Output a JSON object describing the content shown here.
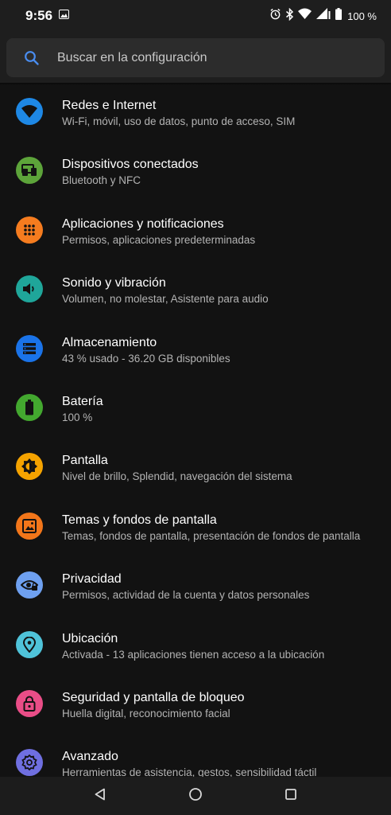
{
  "status_bar": {
    "time": "9:56",
    "battery_text": "100 %",
    "icons": [
      "image-icon",
      "alarm-icon",
      "bluetooth-icon",
      "wifi-icon",
      "signal-icon",
      "battery-icon"
    ]
  },
  "search": {
    "placeholder": "Buscar en la configuración"
  },
  "settings": [
    {
      "title": "Redes e Internet",
      "subtitle": "Wi-Fi, móvil, uso de datos, punto de acceso, SIM",
      "icon": "wifi-icon",
      "color": "#1e88e5"
    },
    {
      "title": "Dispositivos conectados",
      "subtitle": "Bluetooth y NFC",
      "icon": "devices-icon",
      "color": "#5da43a"
    },
    {
      "title": "Aplicaciones y notificaciones",
      "subtitle": "Permisos, aplicaciones predeterminadas",
      "icon": "apps-grid-icon",
      "color": "#f57c1f"
    },
    {
      "title": "Sonido y vibración",
      "subtitle": "Volumen, no molestar, Asistente para audio",
      "icon": "volume-icon",
      "color": "#1fa69a"
    },
    {
      "title": "Almacenamiento",
      "subtitle": "43 % usado - 36.20 GB disponibles",
      "icon": "storage-icon",
      "color": "#1a73e8"
    },
    {
      "title": "Batería",
      "subtitle": "100 %",
      "icon": "battery-icon",
      "color": "#43a82f"
    },
    {
      "title": "Pantalla",
      "subtitle": "Nivel de brillo, Splendid, navegación del sistema",
      "icon": "brightness-icon",
      "color": "#f5a300"
    },
    {
      "title": "Temas y fondos de pantalla",
      "subtitle": "Temas, fondos de pantalla, presentación de fondos de pantalla",
      "icon": "wallpaper-icon",
      "color": "#f2761a"
    },
    {
      "title": "Privacidad",
      "subtitle": "Permisos, actividad de la cuenta y datos personales",
      "icon": "privacy-eye-icon",
      "color": "#6ea0f0"
    },
    {
      "title": "Ubicación",
      "subtitle": "Activada - 13 aplicaciones tienen acceso a la ubicación",
      "icon": "location-pin-icon",
      "color": "#4fc3d9"
    },
    {
      "title": "Seguridad y pantalla de bloqueo",
      "subtitle": "Huella digital, reconocimiento facial",
      "icon": "lock-icon",
      "color": "#e94d87"
    },
    {
      "title": "Avanzado",
      "subtitle": "Herramientas de asistencia, gestos, sensibilidad táctil",
      "icon": "gear-icon",
      "color": "#6f6fe0"
    }
  ],
  "nav": {
    "icons": [
      "back-icon",
      "home-icon",
      "recents-icon"
    ]
  }
}
